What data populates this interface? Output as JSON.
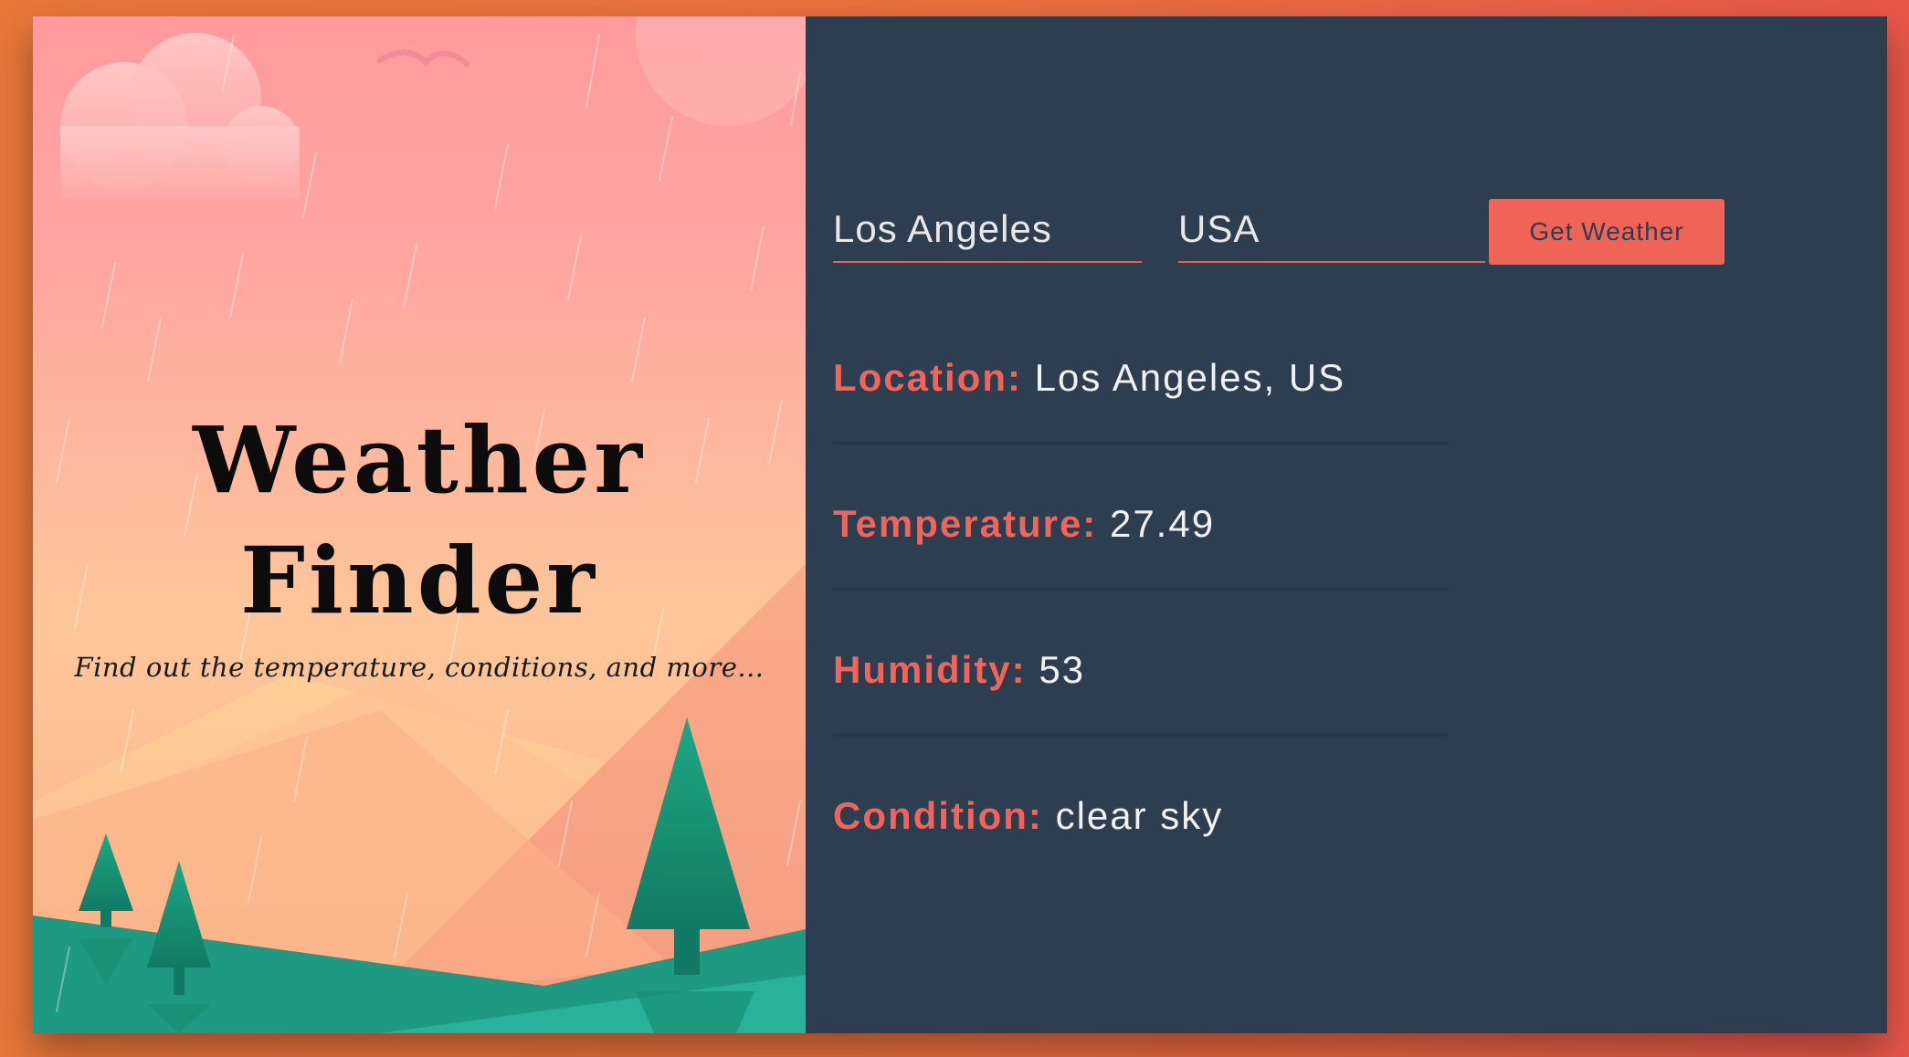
{
  "hero": {
    "title": "Weather\nFinder",
    "subtitle": "Find out the temperature, conditions, and more..."
  },
  "form": {
    "city_value": "Los Angeles",
    "country_value": "USA",
    "submit_label": "Get Weather"
  },
  "results": {
    "location_label": "Location:",
    "location_value": "Los Angeles, US",
    "temperature_label": "Temperature:",
    "temperature_value": "27.49",
    "humidity_label": "Humidity:",
    "humidity_value": "53",
    "condition_label": "Condition:",
    "condition_value": "clear sky"
  },
  "colors": {
    "accent": "#f06457",
    "panel_bg": "#2c3e50",
    "background_gradient": [
      "#e8773a",
      "#e8574a"
    ]
  }
}
